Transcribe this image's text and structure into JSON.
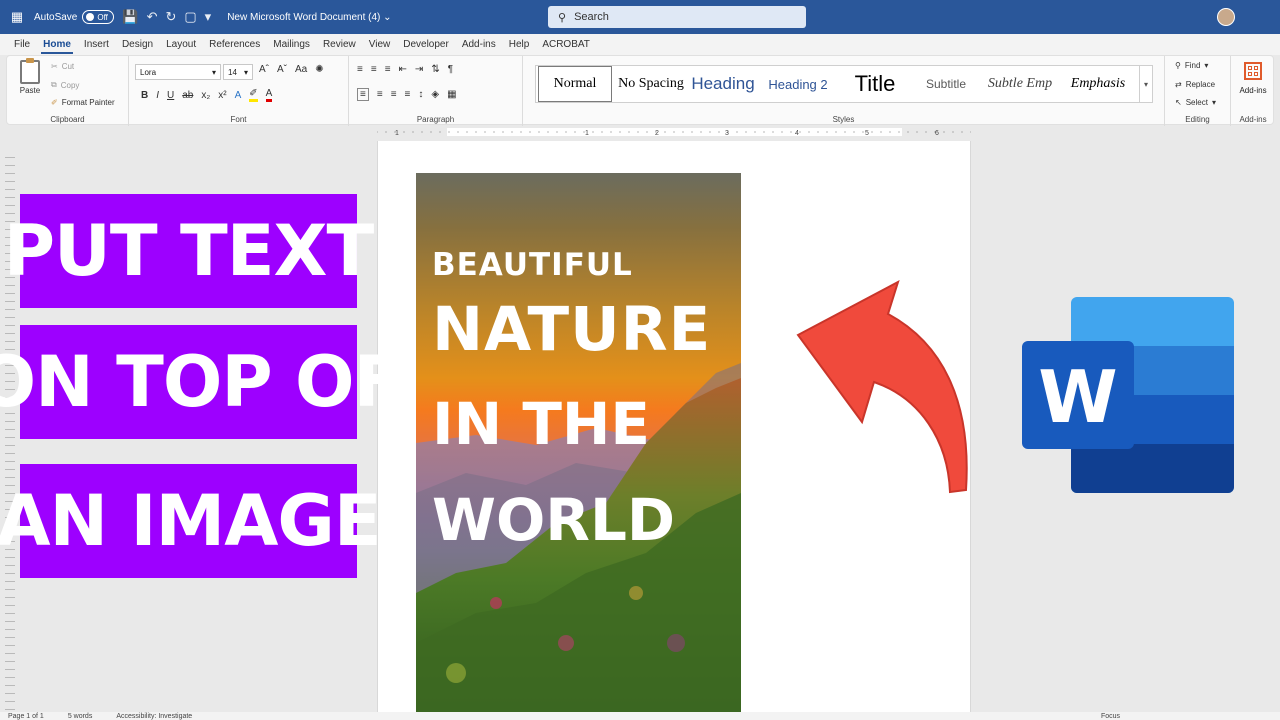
{
  "titlebar": {
    "autosave_label": "AutoSave",
    "autosave_state": "Off",
    "doc_title": "New Microsoft Word Document (4)",
    "search_placeholder": "Search"
  },
  "menu": [
    "File",
    "Home",
    "Insert",
    "Design",
    "Layout",
    "References",
    "Mailings",
    "Review",
    "View",
    "Developer",
    "Add-ins",
    "Help",
    "ACROBAT"
  ],
  "menu_active": "Home",
  "ribbon": {
    "clipboard": {
      "paste": "Paste",
      "cut": "Cut",
      "copy": "Copy",
      "format_painter": "Format Painter",
      "label": "Clipboard"
    },
    "font": {
      "name": "Lora",
      "size": "14",
      "label": "Font"
    },
    "paragraph": {
      "label": "Paragraph"
    },
    "styles": {
      "label": "Styles",
      "items": [
        {
          "name": "Normal",
          "font": "\"Liberation Serif\", serif",
          "size": "14px",
          "color": "#000000",
          "style": "normal",
          "width": 74
        },
        {
          "name": "No Spacing",
          "font": "\"Liberation Serif\", serif",
          "size": "14px",
          "color": "#000000",
          "style": "normal",
          "width": 74
        },
        {
          "name": "Heading",
          "font": "\"Liberation Sans\", sans-serif",
          "size": "17px",
          "color": "#2f5496",
          "style": "normal",
          "width": 70
        },
        {
          "name": "Heading 2",
          "font": "\"Liberation Sans\", sans-serif",
          "size": "13px",
          "color": "#2f5496",
          "style": "normal",
          "width": 80
        },
        {
          "name": "Title",
          "font": "\"Liberation Sans\", sans-serif",
          "size": "22px",
          "color": "#000000",
          "style": "normal",
          "width": 74
        },
        {
          "name": "Subtitle",
          "font": "\"Liberation Sans\", sans-serif",
          "size": "12px",
          "color": "#595959",
          "style": "normal",
          "width": 68
        },
        {
          "name": "Subtle Emp",
          "font": "\"Liberation Serif\", serif",
          "size": "14px",
          "color": "#404040",
          "style": "italic",
          "width": 80
        },
        {
          "name": "Emphasis",
          "font": "\"Liberation Serif\", serif",
          "size": "14px",
          "color": "#000000",
          "style": "italic",
          "width": 76
        }
      ]
    },
    "editing": {
      "find": "Find",
      "replace": "Replace",
      "select": "Select",
      "label": "Editing"
    },
    "addins": {
      "button": "Add-ins",
      "label": "Add-ins"
    }
  },
  "ruler_numbers": [
    "1",
    "1",
    "2",
    "3",
    "4",
    "5",
    "6"
  ],
  "photo_text": [
    "BEAUTIFUL",
    "NATURE",
    "IN THE",
    "WORLD"
  ],
  "banners": [
    "PUT TEXT",
    "ON TOP OF",
    "AN IMAGE"
  ],
  "word_logo_letter": "W",
  "statusbar": {
    "page": "Page 1 of 1",
    "words": "5 words",
    "accessibility": "Accessibility: Investigate",
    "focus": "Focus"
  },
  "colors": {
    "banner": "#9d00ff",
    "arrow": "#f04a3c",
    "titlebar": "#2a579a"
  }
}
